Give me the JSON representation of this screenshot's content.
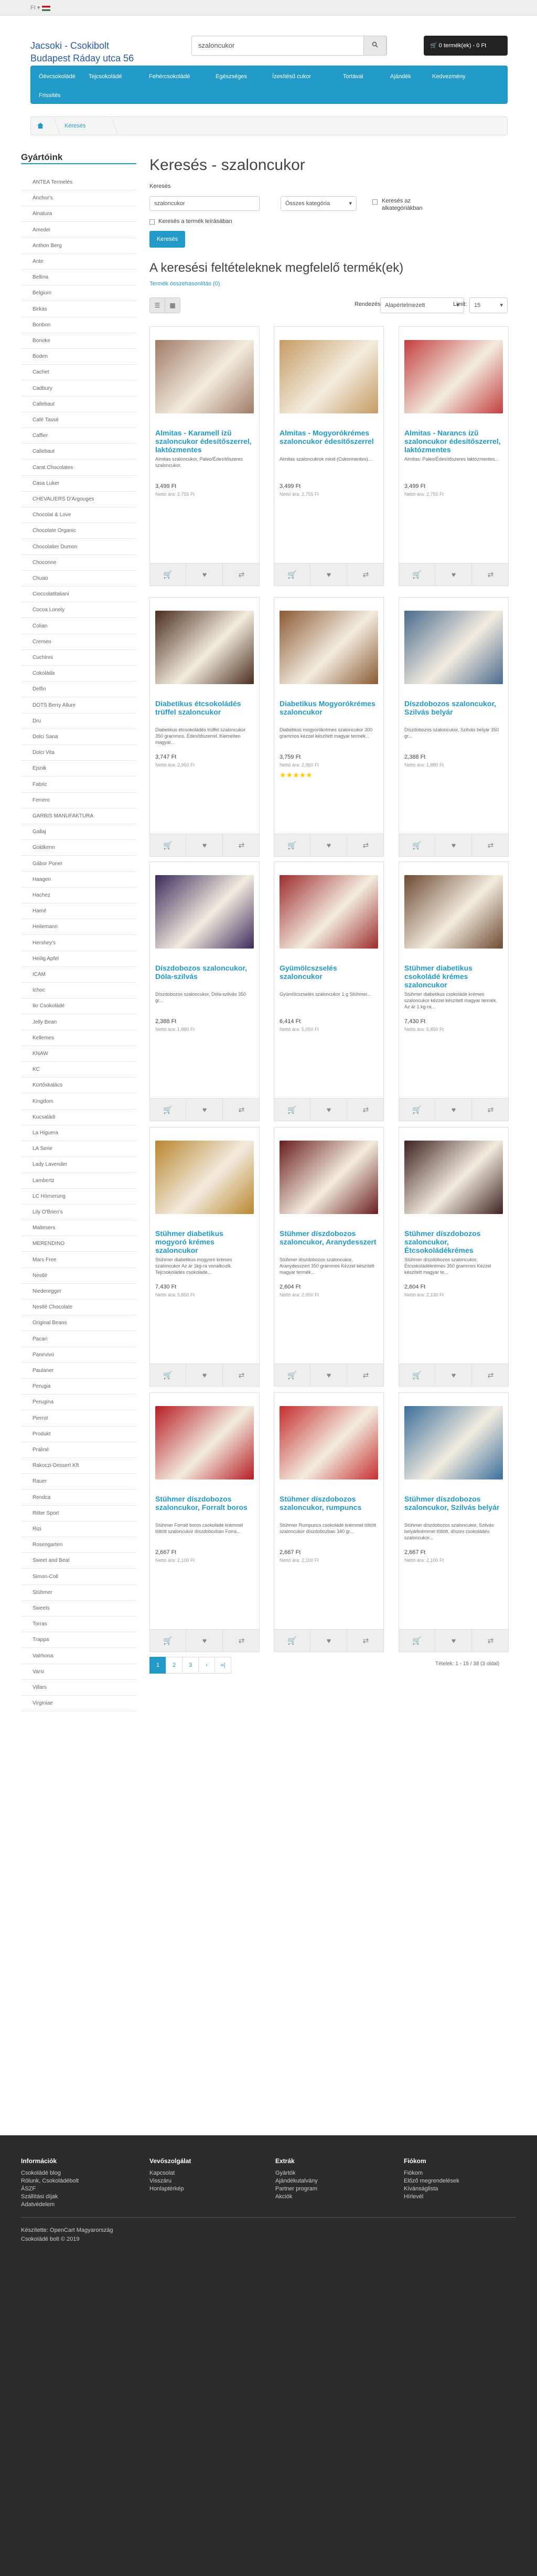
{
  "topbar": {
    "currency": "Ft ▾"
  },
  "store": {
    "logo_line1": "Jacsoki - Csokibolt",
    "logo_line2": "Budapest Ráday utca 56"
  },
  "search": {
    "value": "szaloncukor"
  },
  "cart": {
    "label": "0 termék(ek) - 0 Ft"
  },
  "nav": [
    "Óévcsokoládé",
    "Tejcsokoládé",
    "Fehércsokoládé",
    "Egészséges",
    "Ízesítésű cukor",
    "Tortával",
    "Ajándék",
    "Kedvezmény",
    "Frissítés"
  ],
  "breadcrumb": {
    "current": "Keresés"
  },
  "sidebar": {
    "title": "Gyártóink",
    "items": [
      "ANTEA Termelés",
      "Anchor's",
      "Alnatura",
      "Amedei",
      "Anthon Berg",
      "Ante",
      "Bellina",
      "Belgium",
      "Birkás",
      "Bonbon",
      "Bonoke",
      "Boden",
      "Cachet",
      "Cadbury",
      "Callebaut",
      "Café Tassé",
      "Caffier",
      "Callebaut",
      "Carat Chocolates",
      "Casa Luker",
      "CHEVALIERS D'Argouges",
      "Chocolat & Love",
      "Chocolate Organic",
      "Chocolatier Dumon",
      "Choconne",
      "Chuao",
      "Cioccolatitaliani",
      "Cocoa Lonely",
      "Colian",
      "Cremeo",
      "Cuchinni",
      "Cokoláda",
      "Delfin",
      "DOTS Berry Allure",
      "Dru",
      "Dolci Sana",
      "Dolci Vita",
      "Ejsnik",
      "Fabric",
      "Ferrero",
      "GARBIS MANUFAKTURA",
      "Gallaj",
      "Goldkenn",
      "Gábor Poner",
      "Haagen",
      "Hachez",
      "Hamé",
      "Heilemann",
      "Hershey's",
      "Heilig Apfel",
      "ICAM",
      "Ichoc",
      "Ikr Csokoládé",
      "Jelly Bean",
      "Kellemes",
      "KNAW",
      "KC",
      "Kürtőskalács",
      "Kingdom",
      "Kucsaládi",
      "La Higuera",
      "LA Serie",
      "Lady Lavender",
      "Lambertz",
      "LC Hörnerung",
      "Lily O'Brien's",
      "Maltesers",
      "MERENDINO",
      "Mars Free",
      "Nestlé",
      "Niederegger",
      "Nestlé Chocolate",
      "Original Beans",
      "Pacari",
      "Panevivo",
      "Paulaner",
      "Perugia",
      "Perugina",
      "Pierrot",
      "Produkt",
      "Praliné",
      "Rakoczi-Dessert Kft",
      "Rauer",
      "Rendca",
      "Ritter Sport",
      "Rizi",
      "Rosengarten",
      "Sweet and Beat",
      "Simon-Coll",
      "Stühmer",
      "Sweets",
      "Torras",
      "Trappa",
      "Valrhona",
      "Varsi",
      "Villars",
      "Virginiae"
    ]
  },
  "page": {
    "title": "Keresés - szaloncukor",
    "search_label": "Keresés",
    "search_value": "szaloncukor",
    "category": "Összes kategória",
    "subcat_label": "Keresés az alkategóriákban",
    "desc_label": "Keresés a termék leírásában",
    "button": "Keresés",
    "results_title": "A keresési feltételeknek megfelelő termék(ek)",
    "compare": "Termék összehasonlítás (0)",
    "sort_label": "Rendezés:",
    "sort_value": "Alapértelmezett",
    "limit_label": "Limit:",
    "limit_value": "15"
  },
  "products": [
    {
      "name": "Almitas - Karamell ízű szaloncukor édesítőszerrel, laktózmentes",
      "desc": "Almitas szaloncukor. Paleo/Édesítőszeres szaloncukor.",
      "price": "3,499 Ft",
      "old": "Nettó ára: 2,755 Ft",
      "stars": "",
      "img": "#a17b66"
    },
    {
      "name": "Almitas - Mogyorókrémes szaloncukor édesítőszerrel",
      "desc": "Almitas szaloncukrok mind (Cukormentes)...",
      "price": "3,499 Ft",
      "old": "Nettó ára: 2,755 Ft",
      "stars": "",
      "img": "#c69b63"
    },
    {
      "name": "Almitas - Narancs ízű szaloncukor édesítőszerrel, laktózmentes",
      "desc": "Almitas: Paleo/Édesítőszeres laktózmentes...",
      "price": "3,499 Ft",
      "old": "Nettó ára: 2,755 Ft",
      "stars": "",
      "img": "#c23f3f"
    },
    {
      "name": "Diabetikus étcsokoládés trüffel szaloncukor",
      "desc": "Diabetikus étcsokoládés trüffel szaloncukor 350 grammos. Édesítőszerrel. Kiemelten magyar...",
      "price": "3,747 Ft",
      "old": "Nettó ára: 2,950 Ft",
      "stars": "",
      "img": "#4a2d1d"
    },
    {
      "name": "Diabetikus Mogyorókrémes szaloncukor",
      "desc": "Diabetikus mogyorókrémes szaloncukor 300 grammos kézzel készített magyar termék...",
      "price": "3,759 Ft",
      "old": "Nettó ára: 2,960 Ft",
      "stars": "★★★★★",
      "img": "#8a5a33"
    },
    {
      "name": "Díszdobozos szaloncukor, Szilvás belyár",
      "desc": "Díszdobozos szaloncukor, Szilvás belyár 350 gr...",
      "price": "2,388 Ft",
      "old": "Nettó ára: 1,880 Ft",
      "stars": "",
      "img": "#4a6b8f"
    },
    {
      "name": "Díszdobozos szaloncukor, Dóla-szilvás",
      "desc": "Díszdobozos szaloncukor, Dóla-szilvás 350 gr...",
      "price": "2,388 Ft",
      "old": "Nettó ára: 1,880 Ft",
      "stars": "",
      "img": "#3b2b5c"
    },
    {
      "name": "Gyümölcszselés szaloncukor",
      "desc": "Gyümölcszselés szaloncukor 1 g Stühmer...",
      "price": "6,414 Ft",
      "old": "Nettó ára: 5,050 Ft",
      "stars": "",
      "img": "#9d2d2d"
    },
    {
      "name": "Stühmer diabetikus csokoládé krémes szaloncukor",
      "desc": "Stühmer diabetikus csokoládé krémes szaloncukor kézzel készített magyar termék. Az ár 1 kg-ra...",
      "price": "7,430 Ft",
      "old": "Nettó ára: 5,850 Ft",
      "stars": "",
      "img": "#6d4a32"
    },
    {
      "name": "Stühmer diabetikus mogyoró krémes szaloncukor",
      "desc": "Stühmer diabetikus mogyoró krémes szaloncukor Az ár 1kg-ra vonatkozik. Tejcsokoládés csokoládé...",
      "price": "7,430 Ft",
      "old": "Nettó ára: 5,850 Ft",
      "stars": "",
      "img": "#b9862e"
    },
    {
      "name": "Stühmer díszdobozos szaloncukor, Aranydesszert",
      "desc": "Stühmer díszdobozos szaloncukor, Aranydesszert 350 grammos Kézzel készített magyar termék...",
      "price": "2,604 Ft",
      "old": "Nettó ára: 2,050 Ft",
      "stars": "",
      "img": "#6a1d1d"
    },
    {
      "name": "Stühmer díszdobozos szaloncukor, Étcsokoládékrémes",
      "desc": "Stühmer díszdobozos szaloncukor, Étcsokoládékrémes 350 grammos Kézzel készített magyar te...",
      "price": "2,604 Ft",
      "old": "Nettó ára: 2,130 Ft",
      "stars": "",
      "img": "#3d2020"
    },
    {
      "name": "Stühmer díszdobozos szaloncukor, Forralt boros",
      "desc": "Stühmer Forralt boros csokoládé krémmel töltött szaloncukor díszdobozban Forra...",
      "price": "2,667 Ft",
      "old": "Nettó ára: 2,100 Ft",
      "stars": "",
      "img": "#b71d24"
    },
    {
      "name": "Stühmer díszdobozos szaloncukor, rumpuncs",
      "desc": "Stühmer Rumpuncs csokoládé krémmel töltött szaloncukor díszdobozban 340 gr...",
      "price": "2,667 Ft",
      "old": "Nettó ára: 2,100 Ft",
      "stars": "",
      "img": "#c62f2f"
    },
    {
      "name": "Stühmer díszdobozos szaloncukor, Szilvás belyár",
      "desc": "Stühmer díszdobozos szaloncukor, Szilvás belyárkrémmel töltött, díszes csokoládés szaloncukor...",
      "price": "2,667 Ft",
      "old": "Nettó ára: 2,100 Ft",
      "stars": "",
      "img": "#3a6f9c"
    }
  ],
  "pagination": {
    "pages": [
      "1",
      "2",
      "3",
      "›",
      "»|"
    ],
    "summary": "Tételek: 1 - 15 / 38 (3 oldal)"
  },
  "footer": {
    "cols": [
      {
        "title": "Információk",
        "links": [
          "Csokoládé blog",
          "Rólunk, Csokoládébolt",
          "ÁSZF",
          "Szállítási díjak",
          "Adatvédelem"
        ]
      },
      {
        "title": "Vevőszolgálat",
        "links": [
          "Kapcsolat",
          "Visszáru",
          "Honlaptérkép"
        ]
      },
      {
        "title": "Extrák",
        "links": [
          "Gyártók",
          "Ajándékutalvány",
          "Partner program",
          "Akciók"
        ]
      },
      {
        "title": "Fiókom",
        "links": [
          "Fiókom",
          "Előző megrendelések",
          "Kívánságlista",
          "Hírlevél"
        ]
      }
    ],
    "powered": "Készítette: OpenCart Magyarország",
    "copyright": "Csokoládé bolt © 2019"
  }
}
